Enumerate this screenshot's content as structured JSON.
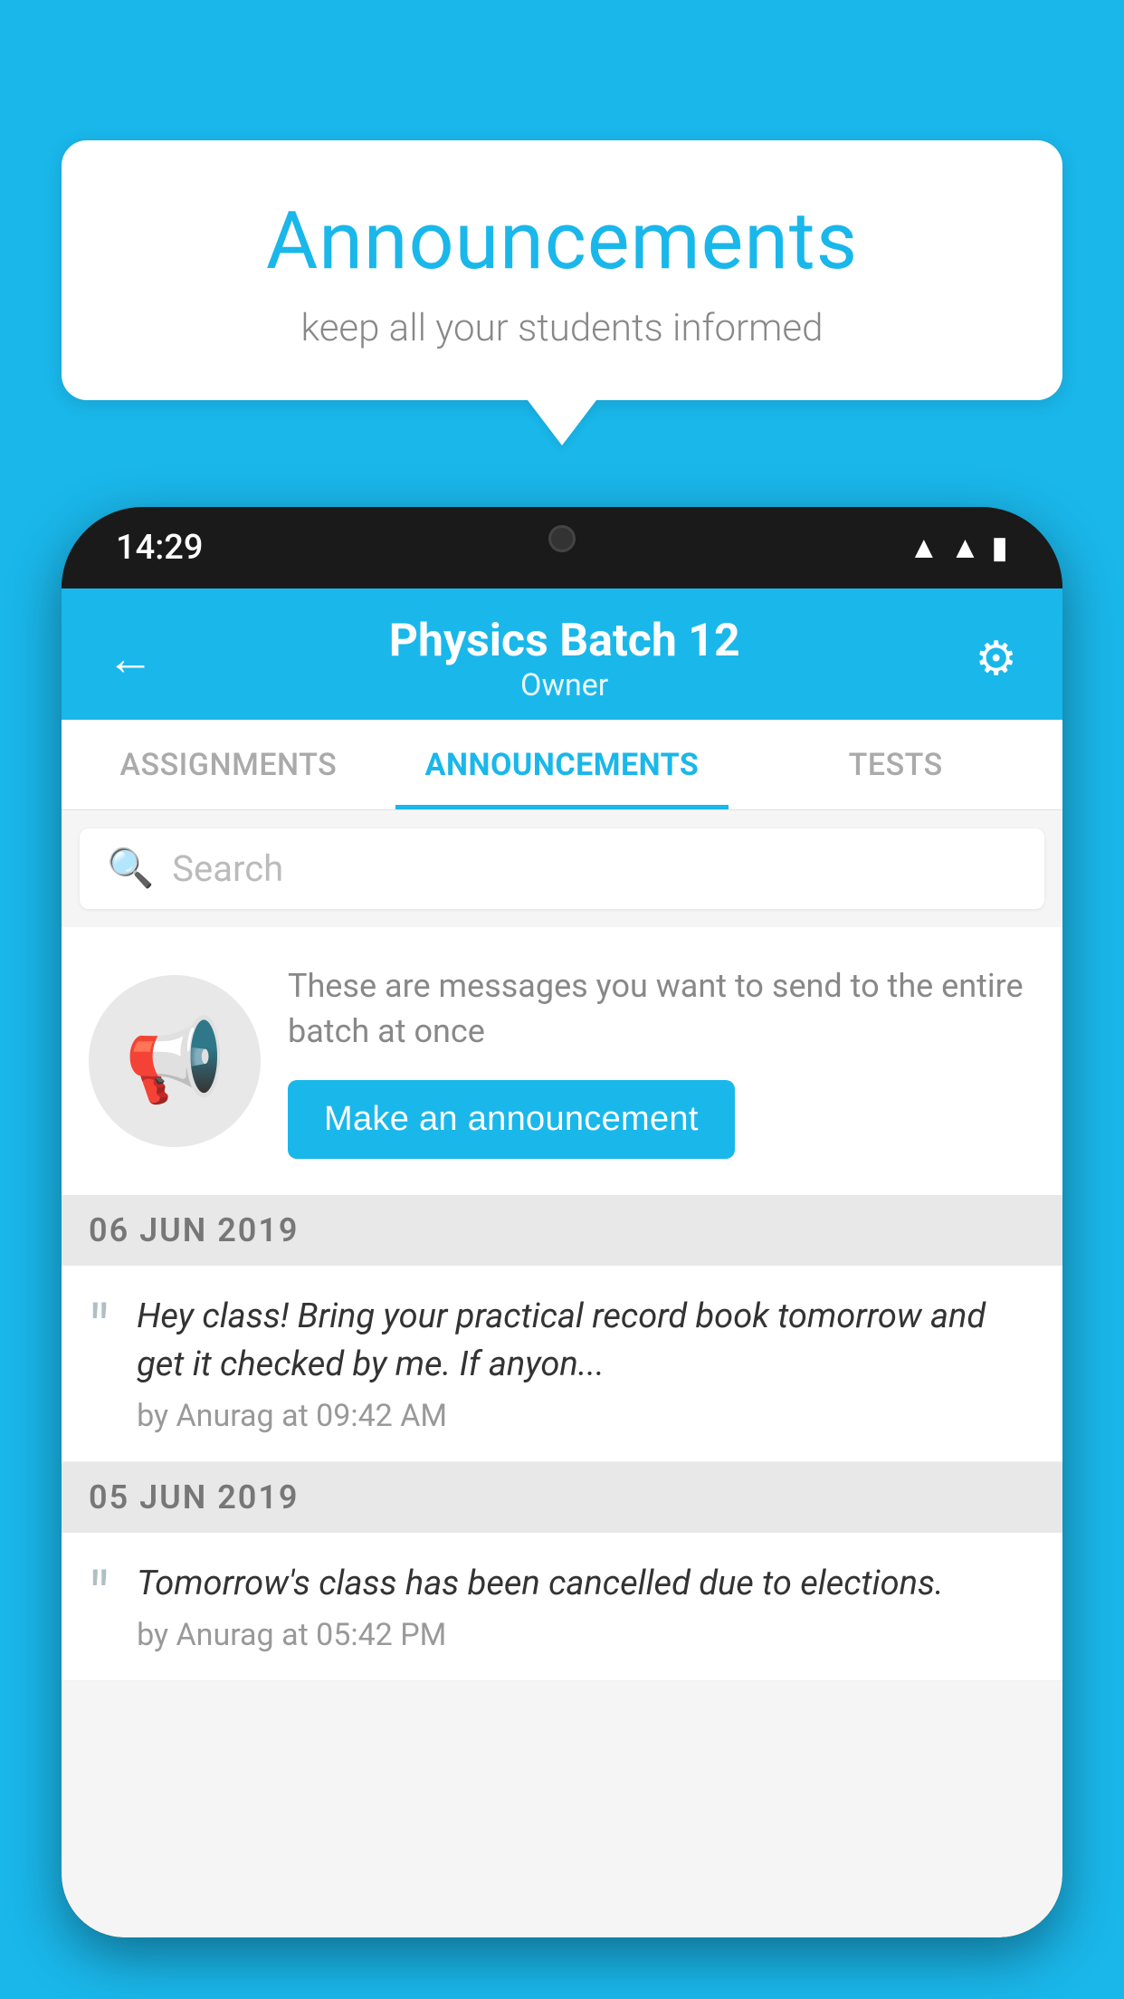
{
  "background_color": "#1ab7ea",
  "speech_bubble": {
    "title": "Announcements",
    "subtitle": "keep all your students informed"
  },
  "phone": {
    "status_bar": {
      "time": "14:29"
    },
    "header": {
      "back_label": "←",
      "title": "Physics Batch 12",
      "subtitle": "Owner",
      "settings_label": "⚙"
    },
    "tabs": [
      {
        "label": "ASSIGNMENTS",
        "active": false
      },
      {
        "label": "ANNOUNCEMENTS",
        "active": true
      },
      {
        "label": "TESTS",
        "active": false
      }
    ],
    "search": {
      "placeholder": "Search"
    },
    "promo": {
      "description": "These are messages you want to send to the entire batch at once",
      "button_label": "Make an announcement"
    },
    "announcements": [
      {
        "date": "06  JUN  2019",
        "text": "Hey class! Bring your practical record book tomorrow and get it checked by me. If anyon...",
        "meta": "by Anurag at 09:42 AM"
      },
      {
        "date": "05  JUN  2019",
        "text": "Tomorrow's class has been cancelled due to elections.",
        "meta": "by Anurag at 05:42 PM"
      }
    ]
  }
}
